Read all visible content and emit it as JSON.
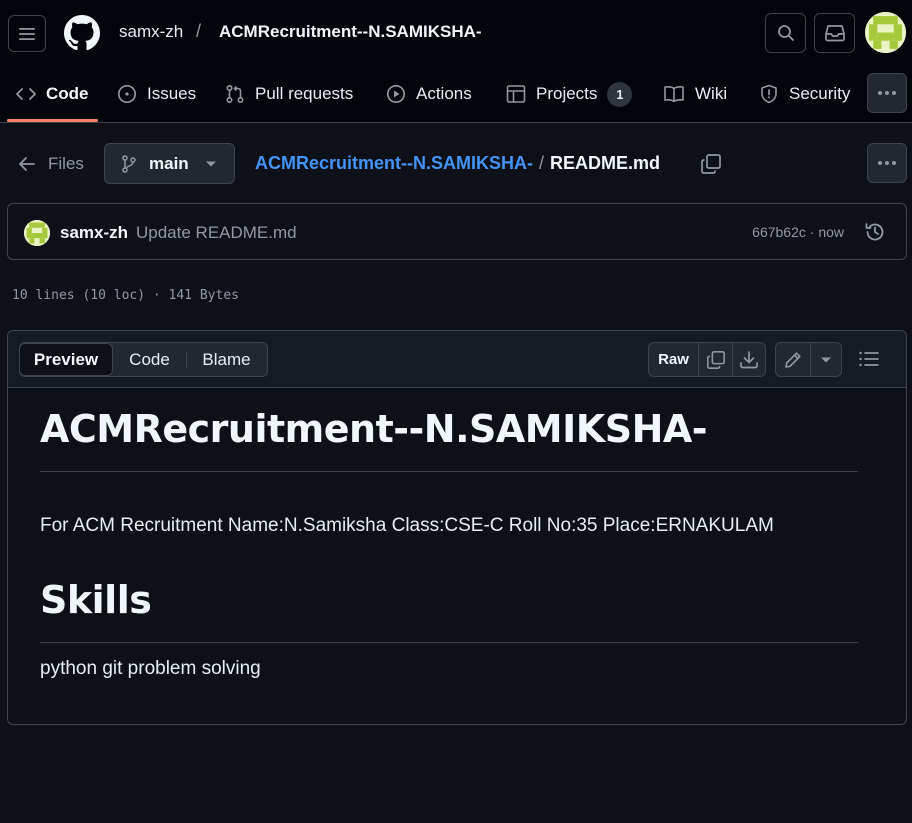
{
  "header": {
    "owner": "samx-zh",
    "separator": "/",
    "repo": "ACMRecruitment--N.SAMIKSHA-"
  },
  "nav": {
    "tabs": [
      {
        "label": "Code",
        "icon": "code-icon",
        "active": true
      },
      {
        "label": "Issues",
        "icon": "issue-opened-icon"
      },
      {
        "label": "Pull requests",
        "icon": "git-pull-request-icon"
      },
      {
        "label": "Actions",
        "icon": "play-icon"
      },
      {
        "label": "Projects",
        "icon": "table-icon",
        "count": "1"
      },
      {
        "label": "Wiki",
        "icon": "book-icon"
      },
      {
        "label": "Security",
        "icon": "shield-icon"
      }
    ]
  },
  "breadcrumb": {
    "files_label": "Files",
    "branch": "main",
    "repo": "ACMRecruitment--N.SAMIKSHA-",
    "separator": "/",
    "file": "README.md"
  },
  "commit": {
    "author": "samx-zh",
    "message": "Update README.md",
    "meta": "667b62c · now"
  },
  "file_info": "10 lines (10 loc) · 141 Bytes",
  "viewer": {
    "tabs": [
      "Preview",
      "Code",
      "Blame"
    ],
    "selected_tab": "Preview",
    "raw_label": "Raw"
  },
  "readme": {
    "title": "ACMRecruitment--N.SAMIKSHA-",
    "intro": "For ACM Recruitment Name:N.Samiksha Class:CSE-C Roll No:35 Place:ERNAKULAM",
    "skills_heading": "Skills",
    "skills_text": "python git problem solving"
  },
  "colors": {
    "background": "#0d1117",
    "header_bg": "#010409",
    "accent_underline": "#f78166",
    "link": "#4493f8",
    "border": "#3d444d",
    "muted_text": "#9198a1"
  }
}
